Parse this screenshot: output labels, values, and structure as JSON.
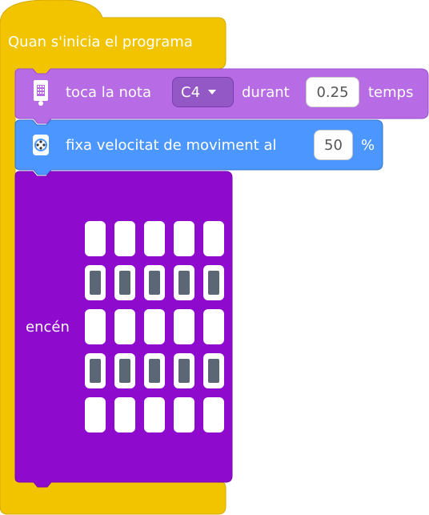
{
  "colors": {
    "event": "#f2c400",
    "music": "#b76be5",
    "movement": "#4c97ff",
    "display": "#8e0bcd"
  },
  "hat": {
    "label": "Quan s'inicia el programa"
  },
  "music_block": {
    "icon": "hub-matrix-icon",
    "text_before": "toca la nota",
    "note_value": "C4",
    "text_middle": "durant",
    "duration_value": "0.25",
    "text_after": "temps"
  },
  "move_block": {
    "icon": "motor-wheel-icon",
    "text_before": "fixa velocitat de moviment al",
    "speed_value": "50",
    "text_after": "%"
  },
  "led_block": {
    "label": "encén",
    "grid": [
      [
        0,
        0,
        0,
        0,
        0
      ],
      [
        1,
        1,
        1,
        1,
        1
      ],
      [
        0,
        0,
        0,
        0,
        0
      ],
      [
        1,
        1,
        1,
        1,
        1
      ],
      [
        0,
        0,
        0,
        0,
        0
      ]
    ]
  }
}
